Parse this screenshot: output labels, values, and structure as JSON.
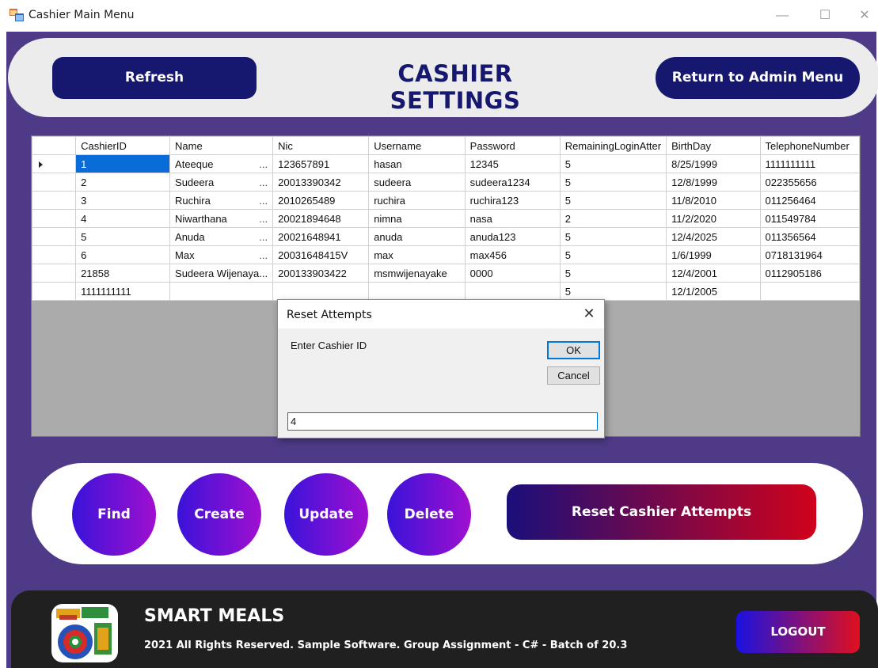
{
  "window": {
    "title": "Cashier Main Menu",
    "icon": "winforms-app-icon",
    "controls": [
      "minimize-icon",
      "maximize-icon",
      "close-icon"
    ]
  },
  "header": {
    "refresh_label": "Refresh",
    "title": "CASHIER SETTINGS",
    "return_label": "Return to Admin Menu"
  },
  "grid": {
    "columns": [
      "CashierID",
      "Name",
      "Nic",
      "Username",
      "Password",
      "RemainingLoginAtter",
      "BirthDay",
      "TelephoneNumber"
    ],
    "rows": [
      [
        "1",
        "Ateeque",
        "123657891",
        "hasan",
        "12345",
        "5",
        "8/25/1999",
        "1111111111"
      ],
      [
        "2",
        "Sudeera",
        "20013390342",
        "sudeera",
        "sudeera1234",
        "5",
        "12/8/1999",
        "022355656"
      ],
      [
        "3",
        "Ruchira",
        "2010265489",
        "ruchira",
        "ruchira123",
        "5",
        "11/8/2010",
        "011256464"
      ],
      [
        "4",
        "Niwarthana",
        "20021894648",
        "nimna",
        "nasa",
        "2",
        "11/2/2020",
        "011549784"
      ],
      [
        "5",
        "Anuda",
        "20021648941",
        "anuda",
        "anuda123",
        "5",
        "12/4/2025",
        "011356564"
      ],
      [
        "6",
        "Max",
        "20031648415V",
        "max",
        "max456",
        "5",
        "1/6/1999",
        "0718131964"
      ],
      [
        "21858",
        "Sudeera Wijenaya...",
        "200133903422",
        "msmwijenayake",
        "0000",
        "5",
        "12/4/2001",
        "0112905186"
      ],
      [
        "1111111111",
        "",
        "",
        "",
        "",
        "5",
        "12/1/2005",
        ""
      ]
    ],
    "name_ellipsis": "...",
    "selected_row": 0
  },
  "dialog": {
    "title": "Reset Attempts",
    "prompt": "Enter Cashier ID",
    "ok_label": "OK",
    "cancel_label": "Cancel",
    "input_value": "4"
  },
  "actions": {
    "find_label": "Find",
    "create_label": "Create",
    "update_label": "Update",
    "delete_label": "Delete",
    "reset_label": "Reset Cashier Attempts"
  },
  "footer": {
    "brand": "SMART MEALS",
    "copyright": "2021 All Rights Reserved.  Sample Software. Group Assignment - C# - Batch of 20.3",
    "logout_label": "LOGOUT"
  },
  "colors": {
    "background": "#4e3a86",
    "navy": "#16176e",
    "selection": "#0a6cd6",
    "footer": "#202020"
  }
}
